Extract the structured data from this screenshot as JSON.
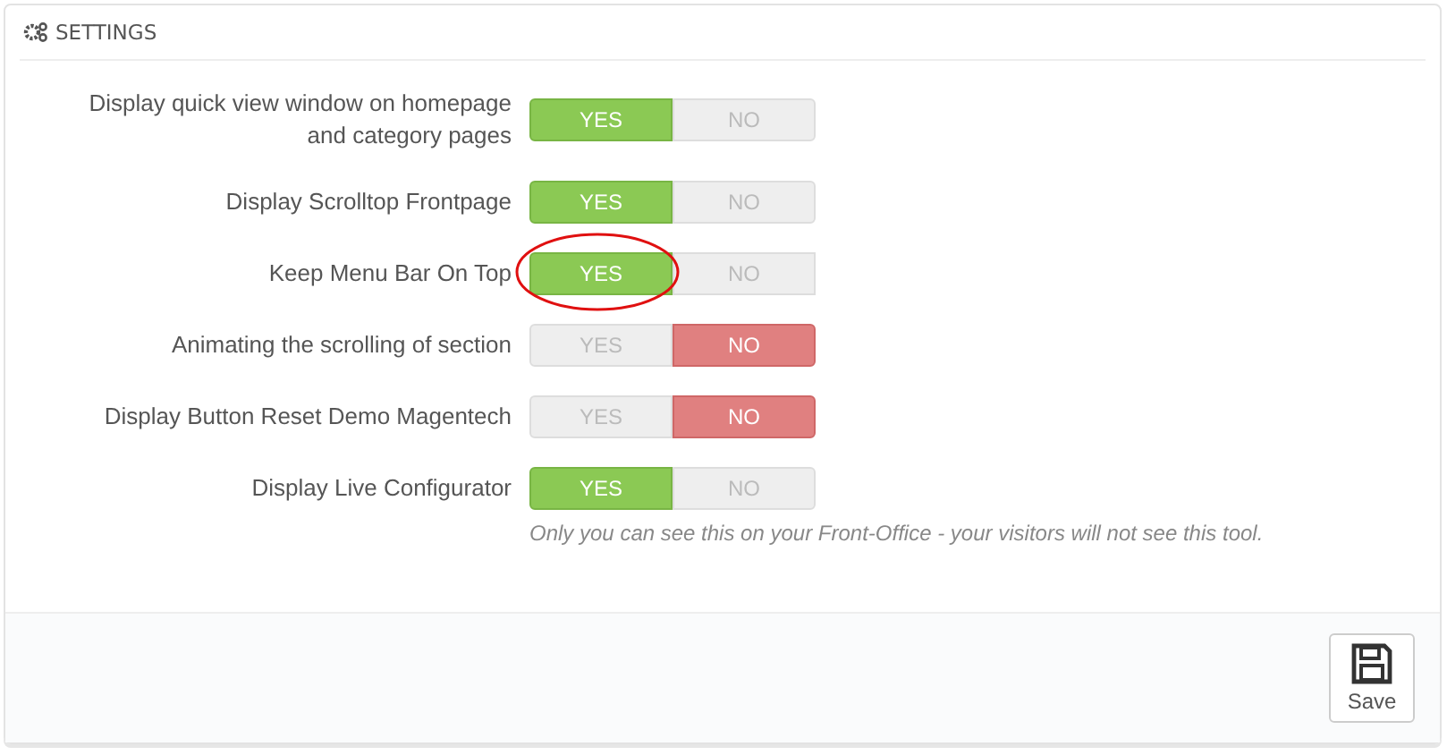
{
  "panel": {
    "title": "SETTINGS"
  },
  "rows": [
    {
      "label": "Display quick view window on homepage and category pages",
      "highlighted": false,
      "options": [
        {
          "kind": "yes",
          "label": "YES",
          "selected": true
        },
        {
          "kind": "no",
          "label": "NO",
          "selected": false
        }
      ]
    },
    {
      "label": "Display Scrolltop Frontpage",
      "highlighted": false,
      "options": [
        {
          "kind": "yes",
          "label": "YES",
          "selected": true
        },
        {
          "kind": "no",
          "label": "NO",
          "selected": false
        }
      ]
    },
    {
      "label": "Keep Menu Bar On Top",
      "highlighted": true,
      "options": [
        {
          "kind": "yes",
          "label": "YES",
          "selected": true
        },
        {
          "kind": "no",
          "label": "NO",
          "selected": false
        }
      ]
    },
    {
      "label": "Animating the scrolling of section",
      "highlighted": false,
      "options": [
        {
          "kind": "yes",
          "label": "YES",
          "selected": false
        },
        {
          "kind": "no",
          "label": "NO",
          "selected": true
        }
      ]
    },
    {
      "label": "Display Button Reset Demo Magentech",
      "highlighted": false,
      "options": [
        {
          "kind": "yes",
          "label": "YES",
          "selected": false
        },
        {
          "kind": "no",
          "label": "NO",
          "selected": true
        }
      ]
    },
    {
      "label": "Display Live Configurator",
      "highlighted": false,
      "options": [
        {
          "kind": "yes",
          "label": "YES",
          "selected": true
        },
        {
          "kind": "no",
          "label": "NO",
          "selected": false
        }
      ],
      "help": "Only you can see this on your Front-Office - your visitors will not see this tool."
    }
  ],
  "footer": {
    "save_button": "Save"
  }
}
